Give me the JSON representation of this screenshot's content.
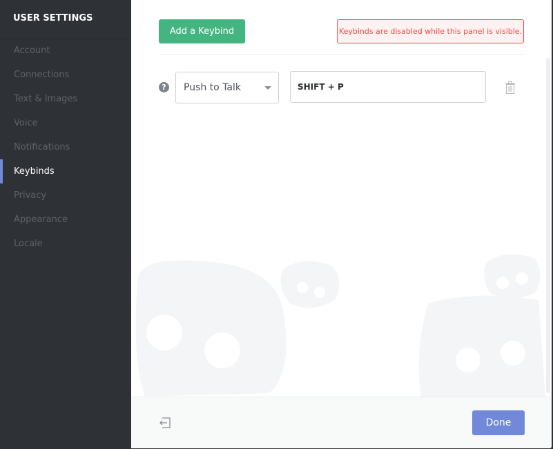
{
  "sidebar": {
    "title": "USER SETTINGS",
    "items": [
      {
        "label": "Account"
      },
      {
        "label": "Connections"
      },
      {
        "label": "Text & Images"
      },
      {
        "label": "Voice"
      },
      {
        "label": "Notifications"
      },
      {
        "label": "Keybinds"
      },
      {
        "label": "Privacy"
      },
      {
        "label": "Appearance"
      },
      {
        "label": "Locale"
      }
    ],
    "active": "Keybinds"
  },
  "main": {
    "add_button_label": "Add a Keybind",
    "warning_text": "Keybinds are disabled while this panel is visible.",
    "keybind": {
      "help_glyph": "?",
      "action_value": "Push to Talk",
      "keys_value": "SHIFT + P"
    }
  },
  "footer": {
    "done_label": "Done"
  },
  "colors": {
    "accent": "#7289da",
    "add_button": "#43b581",
    "warning": "#f04747",
    "sidebar_bg": "#2e3136"
  },
  "icons": {
    "help": "help-icon",
    "dropdown": "chevron-down-icon",
    "delete": "trash-icon",
    "exit": "exit-icon"
  }
}
